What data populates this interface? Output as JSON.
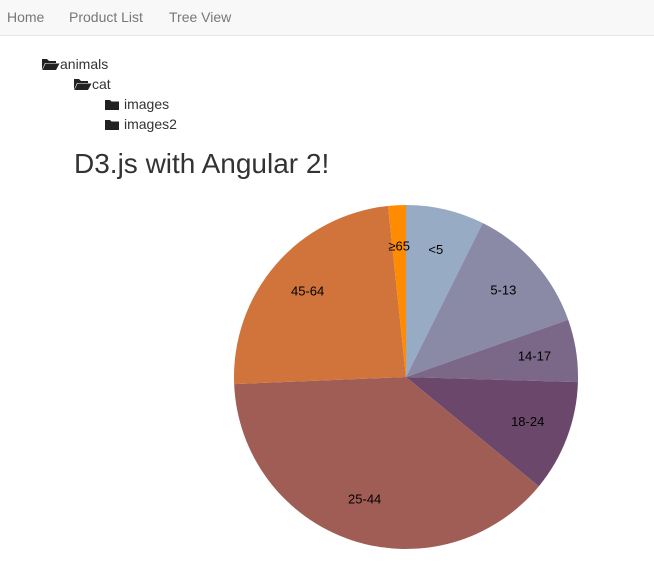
{
  "nav": {
    "items": [
      {
        "label": "Home"
      },
      {
        "label": "Product List"
      },
      {
        "label": "Tree View"
      }
    ]
  },
  "tree": {
    "root": {
      "label": "animals",
      "icon": "folder-open-icon"
    },
    "child": {
      "label": "cat",
      "icon": "folder-open-icon"
    },
    "leaves": [
      {
        "label": "images",
        "icon": "folder-icon"
      },
      {
        "label": "images2",
        "icon": "folder-icon"
      }
    ]
  },
  "page": {
    "title": "D3.js with Angular 2!"
  },
  "chart_data": {
    "type": "pie",
    "categories": [
      "<5",
      "5-13",
      "14-17",
      "18-24",
      "25-44",
      "45-64",
      "≥65"
    ],
    "values": [
      2704659,
      4499890,
      2159981,
      3853788,
      14106543,
      8819342,
      612463
    ],
    "colors": [
      "#98abc5",
      "#8a89a6",
      "#7b6888",
      "#6b486b",
      "#a05d56",
      "#d0743c",
      "#ff8c00"
    ],
    "start": "top",
    "direction": "clockwise"
  }
}
